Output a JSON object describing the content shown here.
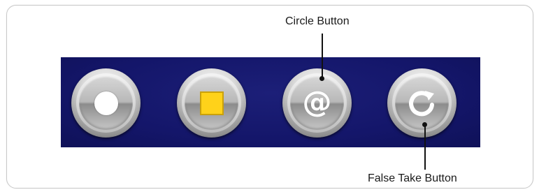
{
  "callouts": {
    "circle_button": "Circle Button",
    "false_take_button": "False Take Button"
  },
  "buttons": [
    {
      "name": "record-button",
      "icon": "record-dot-icon",
      "glyph": ""
    },
    {
      "name": "stop-button",
      "icon": "stop-square-icon",
      "glyph": ""
    },
    {
      "name": "circle-button",
      "icon": "at-sign-icon",
      "glyph": "@"
    },
    {
      "name": "false-take-button",
      "icon": "refresh-arrow-icon",
      "glyph": ""
    }
  ],
  "colors": {
    "panel": "#14166a",
    "stop_square": "#ffd21a"
  }
}
